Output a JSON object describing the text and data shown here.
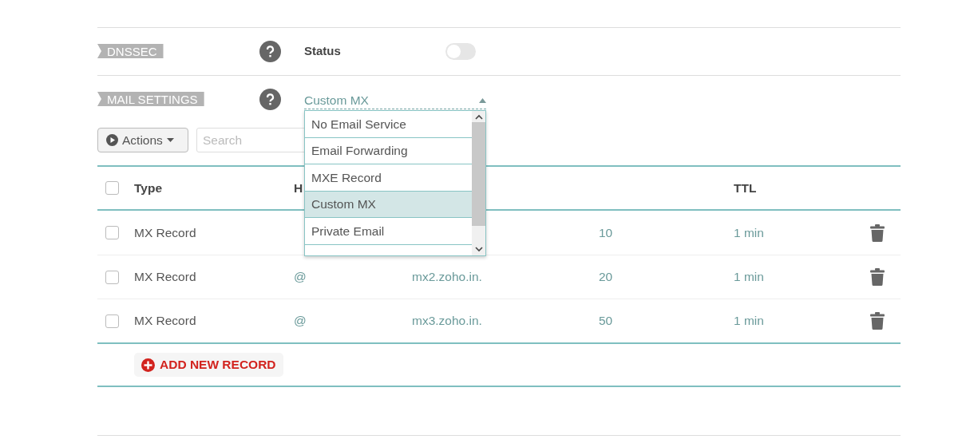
{
  "dnssec": {
    "label": "DNSSEC",
    "status_label": "Status",
    "enabled": false
  },
  "mail_settings": {
    "label": "MAIL SETTINGS",
    "value": "Custom MX",
    "expanded": true,
    "options": [
      {
        "label": "No Email Service",
        "selected": false
      },
      {
        "label": "Email Forwarding",
        "selected": false
      },
      {
        "label": "MXE Record",
        "selected": false
      },
      {
        "label": "Custom MX",
        "selected": true
      },
      {
        "label": "Private Email",
        "selected": false
      }
    ]
  },
  "toolbar": {
    "actions_label": "Actions",
    "search_placeholder": "Search"
  },
  "table": {
    "all_checked": false,
    "columns": [
      "Type",
      "H",
      "TTL"
    ],
    "rows": [
      {
        "checked": false,
        "type": "MX Record",
        "priority": "10",
        "ttl": "1 min"
      },
      {
        "checked": false,
        "type": "MX Record",
        "host": "@",
        "value": "mx2.zoho.in.",
        "priority": "20",
        "ttl": "1 min"
      },
      {
        "checked": false,
        "type": "MX Record",
        "host": "@",
        "value": "mx3.zoho.in.",
        "priority": "50",
        "ttl": "1 min"
      }
    ]
  },
  "add_button": "ADD NEW RECORD"
}
